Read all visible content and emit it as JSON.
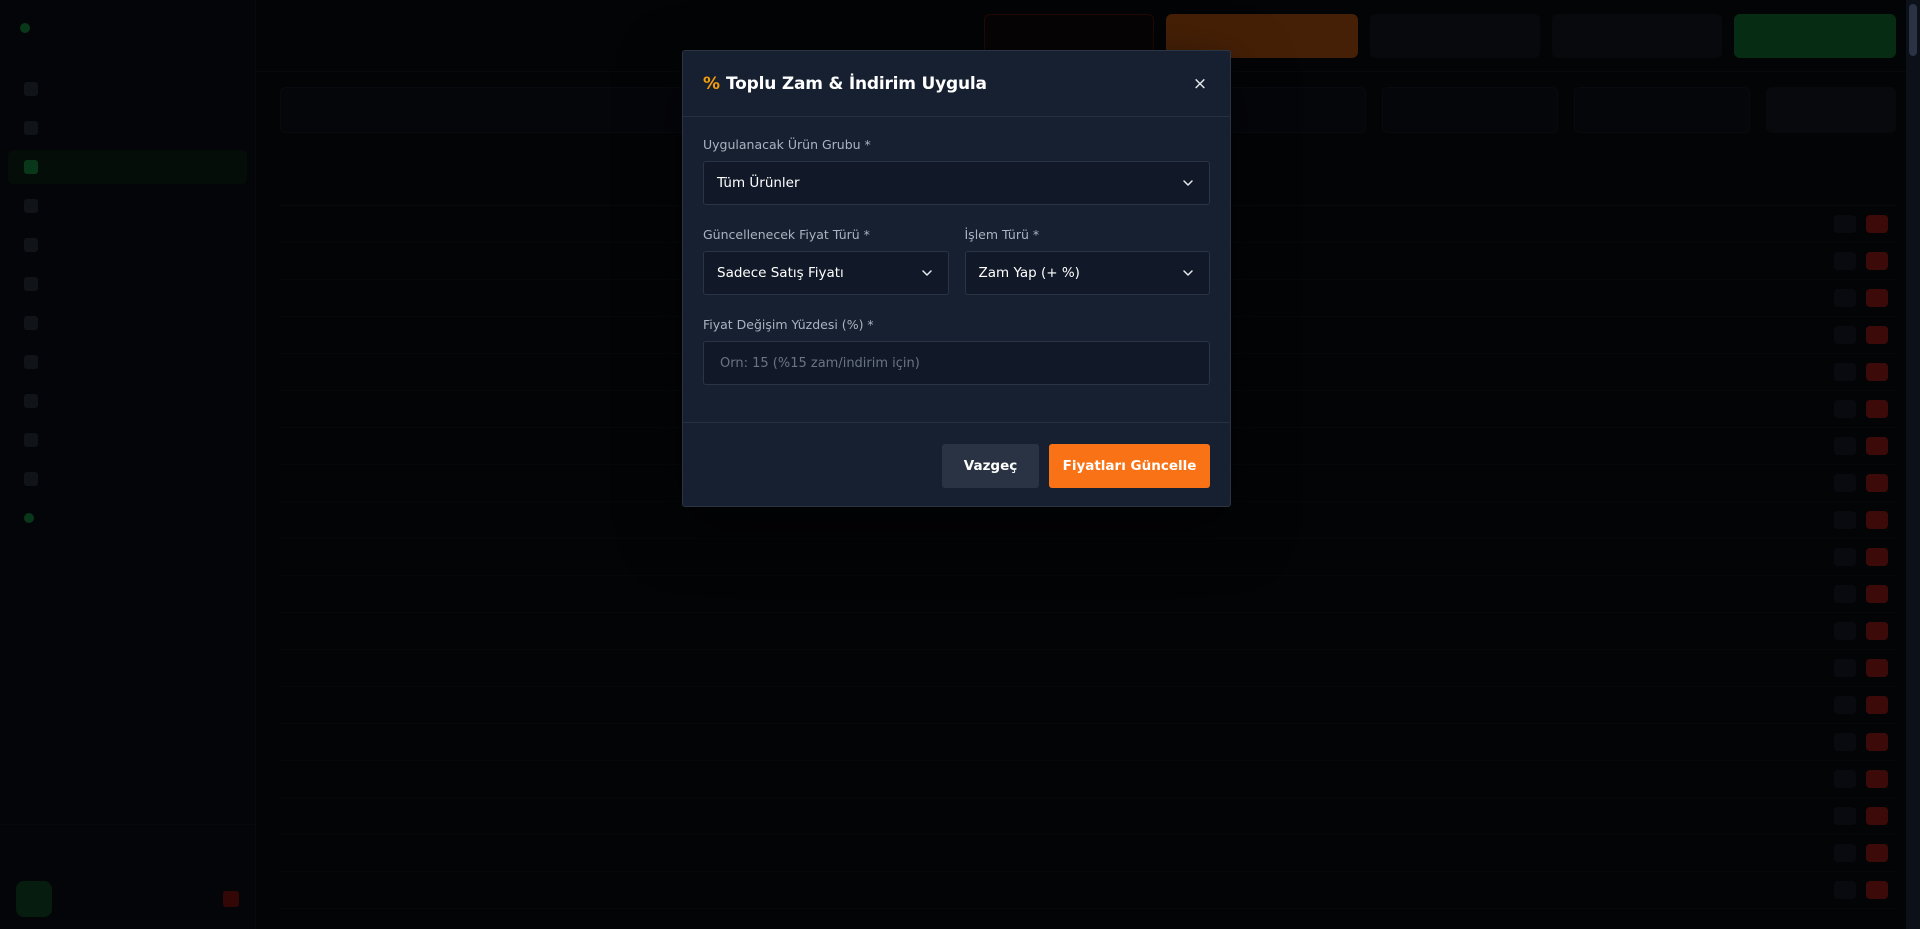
{
  "modal": {
    "title": "Toplu Zam & İndirim Uygula",
    "icon": "percent-icon",
    "close_label": "×",
    "product_group": {
      "label": "Uygulanacak Ürün Grubu *",
      "value": "Tüm Ürünler"
    },
    "price_type": {
      "label": "Güncellenecek Fiyat Türü *",
      "value": "Sadece Satış Fiyatı"
    },
    "operation_type": {
      "label": "İşlem Türü *",
      "value": "Zam Yap (+ %)"
    },
    "percentage": {
      "label": "Fiyat Değişim Yüzdesi (%) *",
      "value": "",
      "placeholder": "Örn: 15 (%15 zam/indirim için)"
    },
    "cancel_label": "Vazgeç",
    "submit_label": "Fiyatları Güncelle"
  },
  "colors": {
    "accent": "#f97316",
    "brand_green": "#22c55e",
    "danger": "#dc2626",
    "modal_bg": "#172030",
    "page_bg": "#0b0f17"
  }
}
